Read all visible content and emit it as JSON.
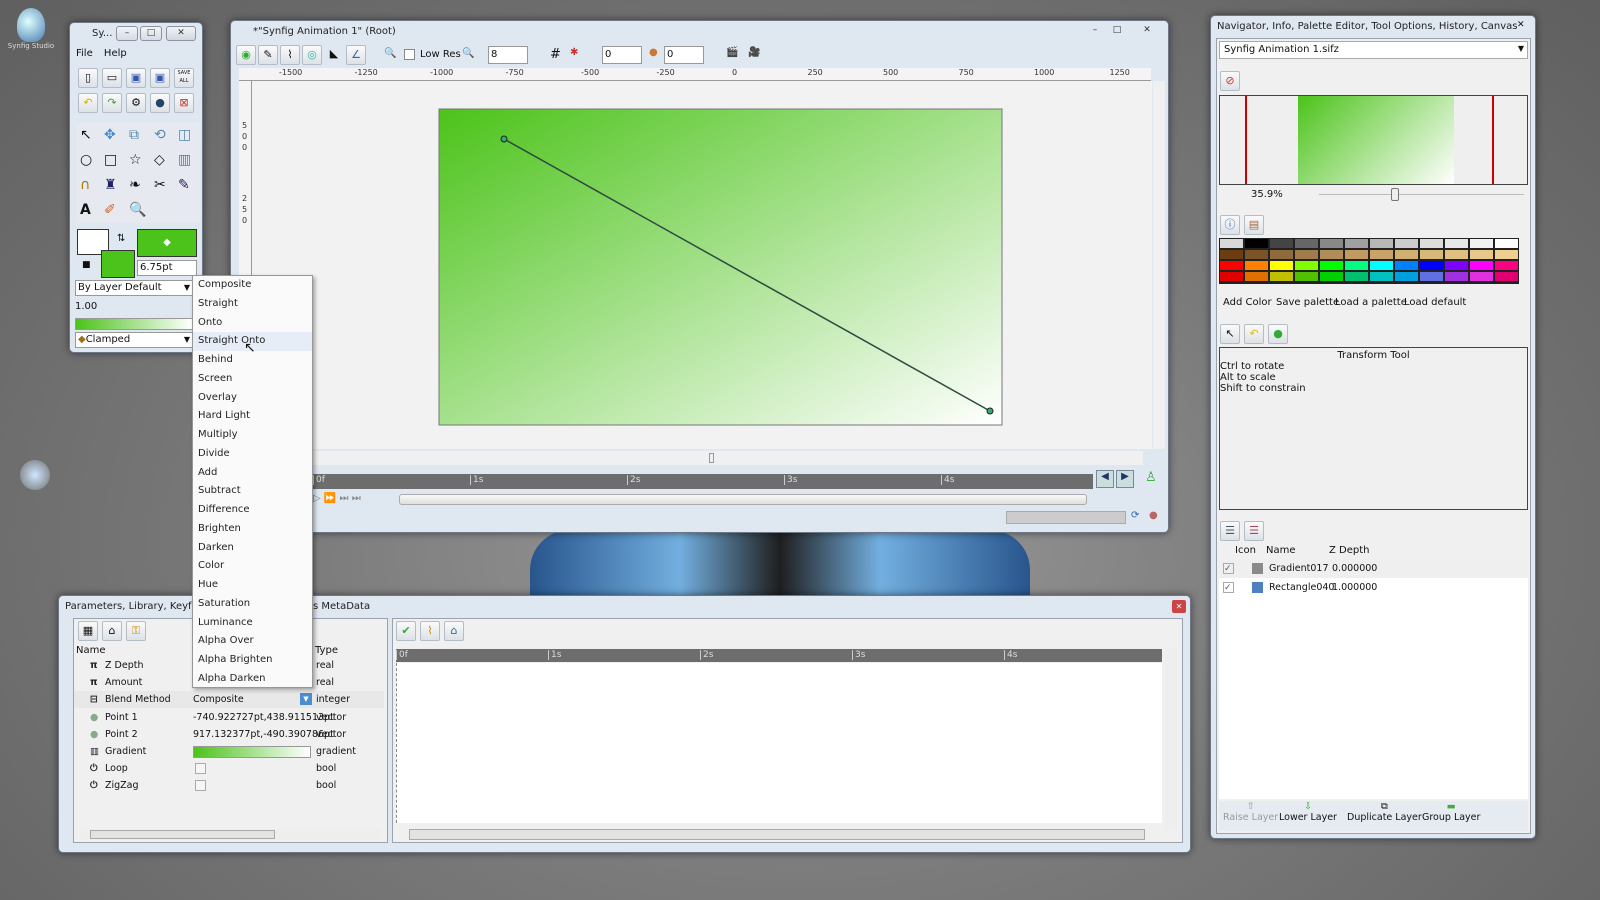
{
  "desktop": {
    "icon_label": "Synfig Studio"
  },
  "toolbox": {
    "title": "Sy...",
    "menu": [
      "File",
      "Help"
    ],
    "save_all": "SAVE ALL",
    "brush_size": "6.75pt",
    "blend_select": "By Layer Default",
    "opacity": "1.00",
    "interpolation": "Clamped",
    "outline_color": "#ffffff",
    "fill_color": "#4cc31a"
  },
  "canvas_window": {
    "title": "*\"Synfig Animation 1\" (Root)",
    "low_res_label": "Low Res",
    "low_res_checked": false,
    "grid_size": "8",
    "onion_past": "0",
    "onion_future": "0",
    "ruler_labels": [
      "-1500",
      "-1250",
      "-1000",
      "-750",
      "-500",
      "-250",
      "0",
      "250",
      "500",
      "750",
      "1000",
      "1250"
    ],
    "vruler_labels": [
      "5",
      "0",
      "0",
      "2",
      "5",
      "0"
    ],
    "time_labels": [
      "0f",
      "1s",
      "2s",
      "3s",
      "4s"
    ],
    "gradient_start": "#4cc31a",
    "gradient_end": "#ffffff"
  },
  "blend_menu": {
    "items": [
      "Composite",
      "Straight",
      "Onto",
      "Straight Onto",
      "Behind",
      "Screen",
      "Overlay",
      "Hard Light",
      "Multiply",
      "Divide",
      "Add",
      "Subtract",
      "Difference",
      "Brighten",
      "Darken",
      "Color",
      "Hue",
      "Saturation",
      "Luminance",
      "Alpha Over",
      "Alpha Brighten",
      "Alpha Darken"
    ],
    "highlighted": "Straight Onto"
  },
  "params_panel": {
    "title_left": "Parameters, Library, Keyframe",
    "title_right": "s MetaData",
    "columns": {
      "name": "Name",
      "type": "Type"
    },
    "rows": [
      {
        "icon": "pi-icon",
        "name": "Z Depth",
        "value": "",
        "type": "real"
      },
      {
        "icon": "pi-icon",
        "name": "Amount",
        "value": "",
        "type": "real"
      },
      {
        "icon": "blend-icon",
        "name": "Blend Method",
        "value": "Composite",
        "type": "integer"
      },
      {
        "icon": "point-icon",
        "name": "Point 1",
        "value": "-740.922727pt,438.911513pt",
        "type": "vector"
      },
      {
        "icon": "point-icon",
        "name": "Point 2",
        "value": "917.132377pt,-490.390786pt",
        "type": "vector"
      },
      {
        "icon": "gradient-icon",
        "name": "Gradient",
        "value": "",
        "type": "gradient"
      },
      {
        "icon": "power-icon",
        "name": "Loop",
        "value": "",
        "type": "bool"
      },
      {
        "icon": "power-icon",
        "name": "ZigZag",
        "value": "",
        "type": "bool"
      }
    ],
    "time_labels": [
      "0f",
      "1s",
      "2s",
      "3s",
      "4s"
    ]
  },
  "right_panel": {
    "title": "Navigator, Info, Palette Editor, Tool Options, History, Canvas Brows...",
    "file_select": "Synfig Animation 1.sifz",
    "zoom": "35.9%",
    "zoom_fraction": 0.36,
    "palette_rows": [
      [
        "#d8d8d8",
        "#000000",
        "#444444",
        "#666666",
        "#888888",
        "#a0a0a0",
        "#b8b8b8",
        "#cccccc",
        "#dcdcdc",
        "#e8e8e8",
        "#f2f2f2",
        "#ffffff"
      ],
      [
        "#6b3d10",
        "#7a5428",
        "#8e6a3c",
        "#a07c4c",
        "#b08c58",
        "#c09a60",
        "#c8a468",
        "#d0b070",
        "#d8b878",
        "#e0c080",
        "#e8c888",
        "#f0d090"
      ],
      [
        "#ff0000",
        "#ff8000",
        "#ffff00",
        "#80ff00",
        "#00ff00",
        "#00ff80",
        "#00ffff",
        "#0080ff",
        "#0000ff",
        "#8000ff",
        "#ff00ff",
        "#ff0080"
      ],
      [
        "#e00000",
        "#e07000",
        "#c0c000",
        "#50c000",
        "#00d000",
        "#00c070",
        "#00c0c0",
        "#00a0e0",
        "#6070e0",
        "#a030e0",
        "#e030e0",
        "#e00070"
      ]
    ],
    "palette_buttons": [
      "Add Color",
      "Save palette",
      "Load a palette",
      "Load default"
    ],
    "tool_title": "Transform Tool",
    "tool_hints": [
      "Ctrl to rotate",
      "Alt to scale",
      "Shift to constrain"
    ],
    "layer_columns": {
      "icon": "Icon",
      "name": "Name",
      "zdepth": "Z Depth"
    },
    "layers": [
      {
        "name": "Gradient017",
        "zdepth": "0.000000",
        "checked": true,
        "color": "#8a8a8a"
      },
      {
        "name": "Rectangle040",
        "zdepth": "1.000000",
        "checked": true,
        "color": "#4f7fbf"
      }
    ],
    "layer_buttons": [
      "Raise Layer",
      "Lower Layer",
      "Duplicate Layer",
      "Group Layer"
    ]
  }
}
